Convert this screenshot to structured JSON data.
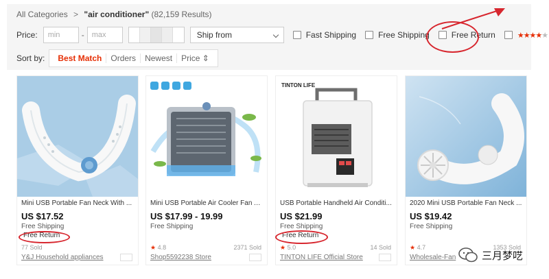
{
  "breadcrumb": {
    "root": "All Categories",
    "separator": ">",
    "query": "\"air conditioner\"",
    "count": "(82,159 Results)"
  },
  "filters": {
    "price_label": "Price:",
    "min_placeholder": "min",
    "max_placeholder": "max",
    "ship_from": "Ship from",
    "fast_shipping": "Fast Shipping",
    "free_shipping": "Free Shipping",
    "free_return": "Free Return",
    "rating_stars": "★★★★",
    "rating_dim": "★"
  },
  "sort": {
    "label": "Sort by:",
    "options": [
      "Best Match",
      "Orders",
      "Newest",
      "Price ⇕"
    ],
    "active_index": 0
  },
  "products": [
    {
      "title": "Mini USB Portable Fan Neck With ...",
      "price": "US $17.52",
      "shipping": "Free Shipping",
      "badge": "Free Return",
      "rating": "",
      "sold": "77 Sold",
      "store": "Y&J Household appliances"
    },
    {
      "title": "Mini USB Portable Air Cooler Fan A...",
      "price": "US $17.99 - 19.99",
      "shipping": "Free Shipping",
      "badge": "",
      "rating": "4.8",
      "sold": "2371 Sold",
      "store": "Shop5592238 Store"
    },
    {
      "title": "USB Portable Handheld Air Conditi...",
      "price": "US $21.99",
      "shipping": "Free Shipping",
      "badge": "Free Return",
      "rating": "5.0",
      "sold": "14 Sold",
      "store": "TINTON LIFE Official Store"
    },
    {
      "title": "2020 Mini USB Portable Fan Neck ...",
      "price": "US $19.42",
      "shipping": "Free Shipping",
      "badge": "",
      "rating": "4.7",
      "sold": "1353 Sold",
      "store": "Wholesale-Fan"
    }
  ],
  "image_text": {
    "brand_logo": "TINTON LIFE"
  },
  "watermark": {
    "text": "三月梦呓"
  },
  "colors": {
    "accent": "#e62e04",
    "annotation": "#d7262e",
    "filter_bg": "#f5f5f5"
  }
}
